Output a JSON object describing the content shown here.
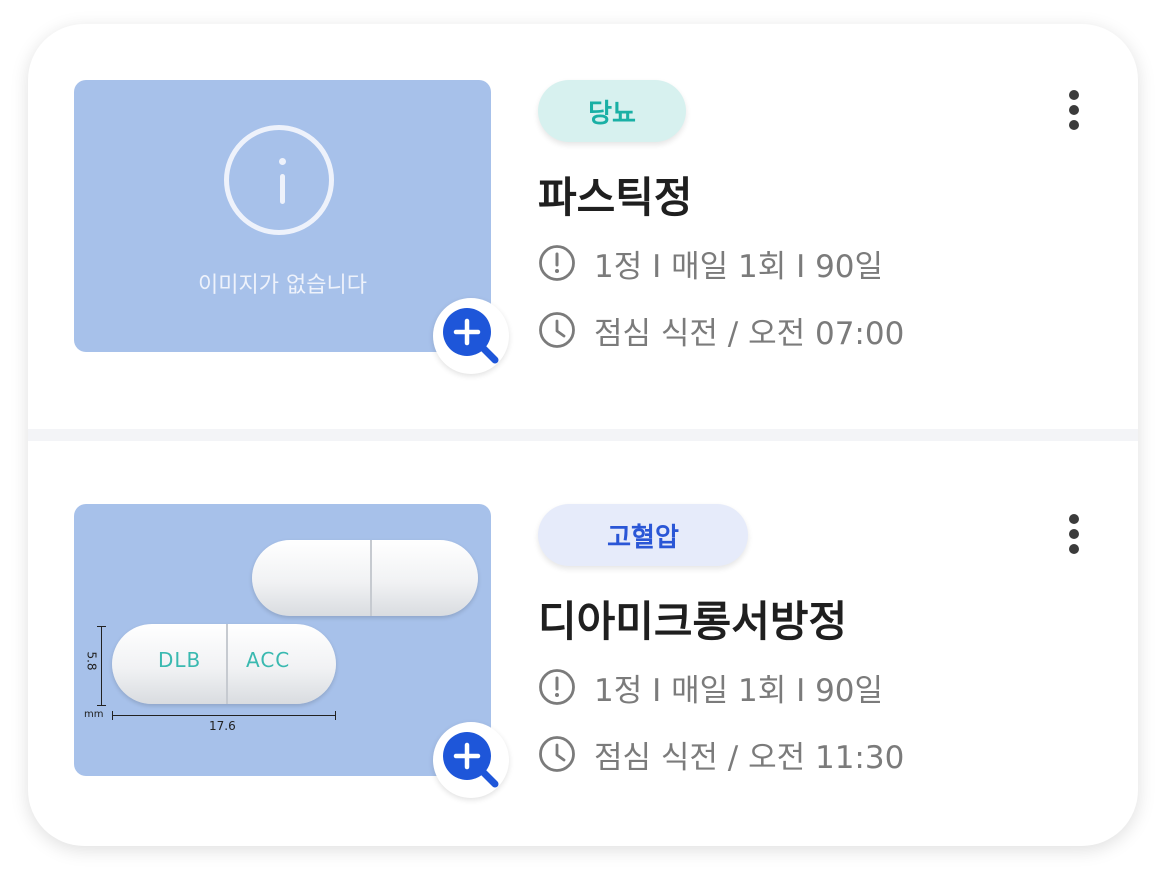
{
  "placeholder": {
    "no_image_text": "이미지가 없습니다"
  },
  "medications": [
    {
      "tag": "당뇨",
      "name": "파스틱정",
      "dosage": "1정 I 매일 1회 I 90일",
      "schedule": "점심 식전 / 오전 07:00",
      "has_image": false
    },
    {
      "tag": "고혈압",
      "name": "디아미크롱서방정",
      "dosage": "1정 I 매일 1회 I 90일",
      "schedule": "점심 식전 / 오전 11:30",
      "has_image": true,
      "capsule_image": {
        "imprint_left": "DLB",
        "imprint_right": "ACC",
        "width_label": "17.6",
        "height_label": "5.8",
        "unit_label": "mm"
      }
    }
  ],
  "colors": {
    "thumb_bg": "#a7c1ea",
    "tag_teal_bg": "#d7f1ef",
    "tag_teal_text": "#19b0a5",
    "tag_blue_bg": "#e6ebfa",
    "tag_blue_text": "#2a56d6",
    "zoom_button": "#1e56d9"
  },
  "icons": {
    "info": "info-circle-icon",
    "alert": "exclamation-circle-icon",
    "clock": "clock-icon",
    "zoom": "zoom-in-icon",
    "menu": "more-vertical-icon"
  }
}
